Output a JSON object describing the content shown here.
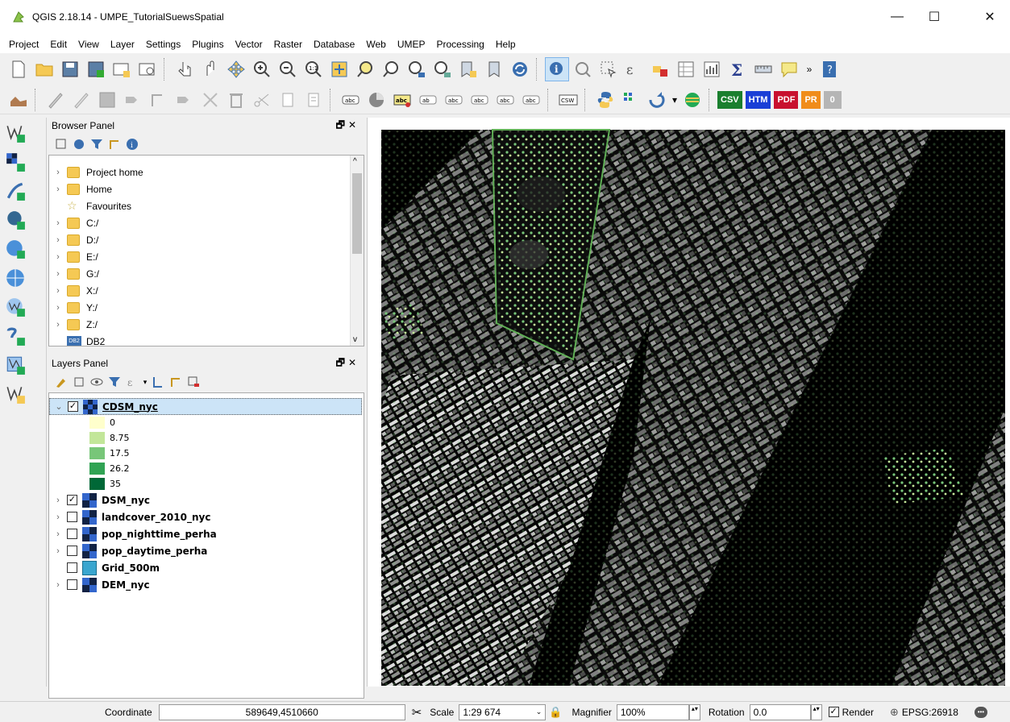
{
  "window": {
    "title": "QGIS 2.18.14 - UMPE_TutorialSuewsSpatial"
  },
  "menu": [
    "Project",
    "Edit",
    "View",
    "Layer",
    "Settings",
    "Plugins",
    "Vector",
    "Raster",
    "Database",
    "Web",
    "UMEP",
    "Processing",
    "Help"
  ],
  "export_buttons": {
    "csv": "CSV",
    "htm": "HTM",
    "pdf": "PDF",
    "pr": "PR",
    "zero": "0"
  },
  "browser_panel": {
    "title": "Browser Panel",
    "items": [
      "Project home",
      "Home",
      "Favourites",
      "C:/",
      "D:/",
      "E:/",
      "G:/",
      "X:/",
      "Y:/",
      "Z:/",
      "DB2"
    ]
  },
  "layers_panel": {
    "title": "Layers Panel",
    "layers": [
      {
        "name": "CDSM_nyc",
        "checked": true,
        "expanded": true
      },
      {
        "name": "DSM_nyc",
        "checked": true
      },
      {
        "name": "landcover_2010_nyc",
        "checked": false
      },
      {
        "name": "pop_nighttime_perha",
        "checked": false
      },
      {
        "name": "pop_daytime_perha",
        "checked": false
      },
      {
        "name": "Grid_500m",
        "checked": false
      },
      {
        "name": "DEM_nyc",
        "checked": false
      }
    ],
    "legend": [
      {
        "label": "0",
        "color": "#ffffcc"
      },
      {
        "label": "8.75",
        "color": "#c2e699"
      },
      {
        "label": "17.5",
        "color": "#78c679"
      },
      {
        "label": "26.2",
        "color": "#31a354"
      },
      {
        "label": "35",
        "color": "#006837"
      }
    ]
  },
  "statusbar": {
    "coordinate_label": "Coordinate",
    "coordinate_value": "589649,4510660",
    "scale_label": "Scale",
    "scale_value": "1:29 674",
    "magnifier_label": "Magnifier",
    "magnifier_value": "100%",
    "rotation_label": "Rotation",
    "rotation_value": "0.0",
    "render_label": "Render",
    "crs": "EPSG:26918"
  },
  "colors": {
    "csv": "#1a7f2e",
    "htm": "#1a3fd6",
    "pdf": "#c8102e",
    "pr": "#f08c1a",
    "zero": "#b5b5b5",
    "selection": "#cce4f7"
  }
}
